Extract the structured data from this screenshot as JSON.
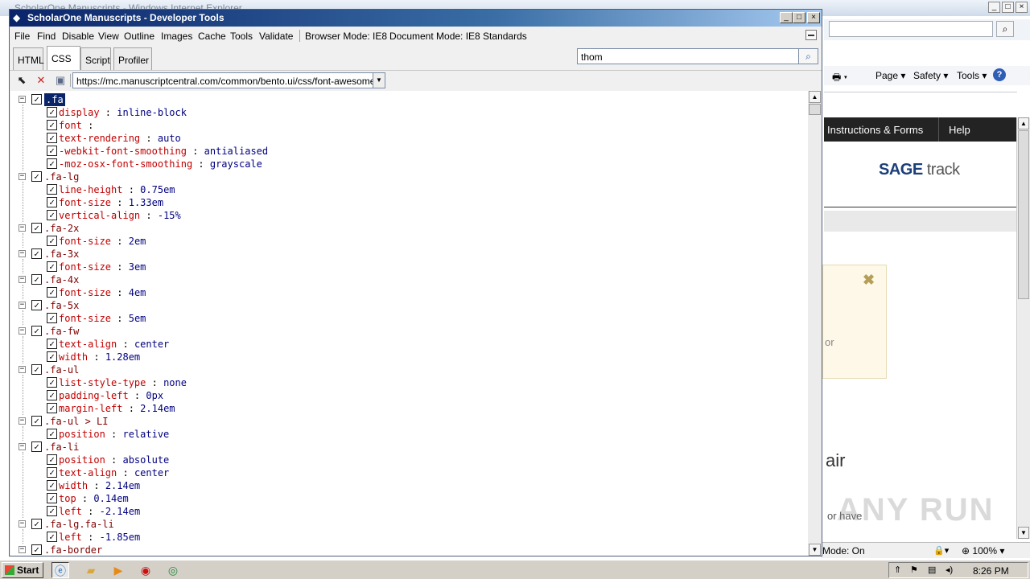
{
  "ie": {
    "title": "ScholarOne Manuscripts - Windows Internet Explorer",
    "commandbar": {
      "page": "Page",
      "safety": "Safety",
      "tools": "Tools",
      "help_icon": "?"
    },
    "site": {
      "nav_instructions": "Instructions & Forms",
      "nav_help": "Help",
      "logo_brand": "SAGE",
      "logo_track": "track",
      "notice_close": "✖",
      "notice_fragment": "or",
      "heading_fragment": "air",
      "text_fragment": "or have"
    },
    "watermark": "ANY RUN",
    "status": {
      "mode": "Mode: On",
      "zoom": "100%"
    }
  },
  "devtools": {
    "title": "ScholarOne Manuscripts - Developer Tools",
    "menu": [
      "File",
      "Find",
      "Disable",
      "View",
      "Outline",
      "Images",
      "Cache",
      "Tools",
      "Validate"
    ],
    "browser_mode": "Browser Mode: IE8",
    "document_mode": "Document Mode: IE8 Standards",
    "tabs": [
      "HTML",
      "CSS",
      "Script",
      "Profiler"
    ],
    "active_tab": "CSS",
    "search_value": "thom",
    "stylesheet_url": "https://mc.manuscriptcentral.com/common/bento.ui/css/font-awesome.css"
  },
  "css_rules": [
    {
      "selector": ".fa",
      "selected": true,
      "props": [
        {
          "name": "display",
          "value": "inline-block"
        },
        {
          "name": "font",
          "value": ""
        },
        {
          "name": "text-rendering",
          "value": "auto"
        },
        {
          "name": "-webkit-font-smoothing",
          "value": "antialiased"
        },
        {
          "name": "-moz-osx-font-smoothing",
          "value": "grayscale"
        }
      ]
    },
    {
      "selector": ".fa-lg",
      "props": [
        {
          "name": "line-height",
          "value": "0.75em"
        },
        {
          "name": "font-size",
          "value": "1.33em"
        },
        {
          "name": "vertical-align",
          "value": "-15%"
        }
      ]
    },
    {
      "selector": ".fa-2x",
      "props": [
        {
          "name": "font-size",
          "value": "2em"
        }
      ]
    },
    {
      "selector": ".fa-3x",
      "props": [
        {
          "name": "font-size",
          "value": "3em"
        }
      ]
    },
    {
      "selector": ".fa-4x",
      "props": [
        {
          "name": "font-size",
          "value": "4em"
        }
      ]
    },
    {
      "selector": ".fa-5x",
      "props": [
        {
          "name": "font-size",
          "value": "5em"
        }
      ]
    },
    {
      "selector": ".fa-fw",
      "props": [
        {
          "name": "text-align",
          "value": "center"
        },
        {
          "name": "width",
          "value": "1.28em"
        }
      ]
    },
    {
      "selector": ".fa-ul",
      "props": [
        {
          "name": "list-style-type",
          "value": "none"
        },
        {
          "name": "padding-left",
          "value": "0px"
        },
        {
          "name": "margin-left",
          "value": "2.14em"
        }
      ]
    },
    {
      "selector": ".fa-ul > LI",
      "props": [
        {
          "name": "position",
          "value": "relative"
        }
      ]
    },
    {
      "selector": ".fa-li",
      "props": [
        {
          "name": "position",
          "value": "absolute"
        },
        {
          "name": "text-align",
          "value": "center"
        },
        {
          "name": "width",
          "value": "2.14em"
        },
        {
          "name": "top",
          "value": "0.14em"
        },
        {
          "name": "left",
          "value": "-2.14em"
        }
      ]
    },
    {
      "selector": ".fa-lg.fa-li",
      "props": [
        {
          "name": "left",
          "value": "-1.85em"
        }
      ]
    },
    {
      "selector": ".fa-border",
      "props": []
    }
  ],
  "taskbar": {
    "start_label": "Start",
    "clock": "8:26 PM"
  }
}
